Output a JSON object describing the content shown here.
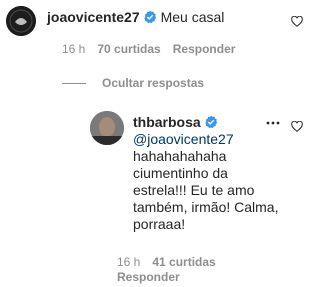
{
  "comment": {
    "username": "joaovicente27",
    "text": "Meu casal",
    "time": "16 h",
    "likes": "70 curtidas",
    "reply_label": "Responder"
  },
  "toggle": {
    "label": "Ocultar respostas"
  },
  "reply": {
    "username": "thbarbosa",
    "mention": "@joaovicente27",
    "text_lines": [
      "hahahahahaha",
      "ciumentinho da",
      "estrela!!! Eu te amo",
      "também, irmão! Calma,",
      "porraaa!"
    ],
    "time": "16 h",
    "likes": "41 curtidas",
    "reply_label": "Responder"
  },
  "colors": {
    "verified": "#3897f0",
    "muted": "#8e8e8e",
    "mention": "#00376b"
  },
  "icons": [
    "heart-icon",
    "verified-badge-icon",
    "more-options-icon"
  ]
}
